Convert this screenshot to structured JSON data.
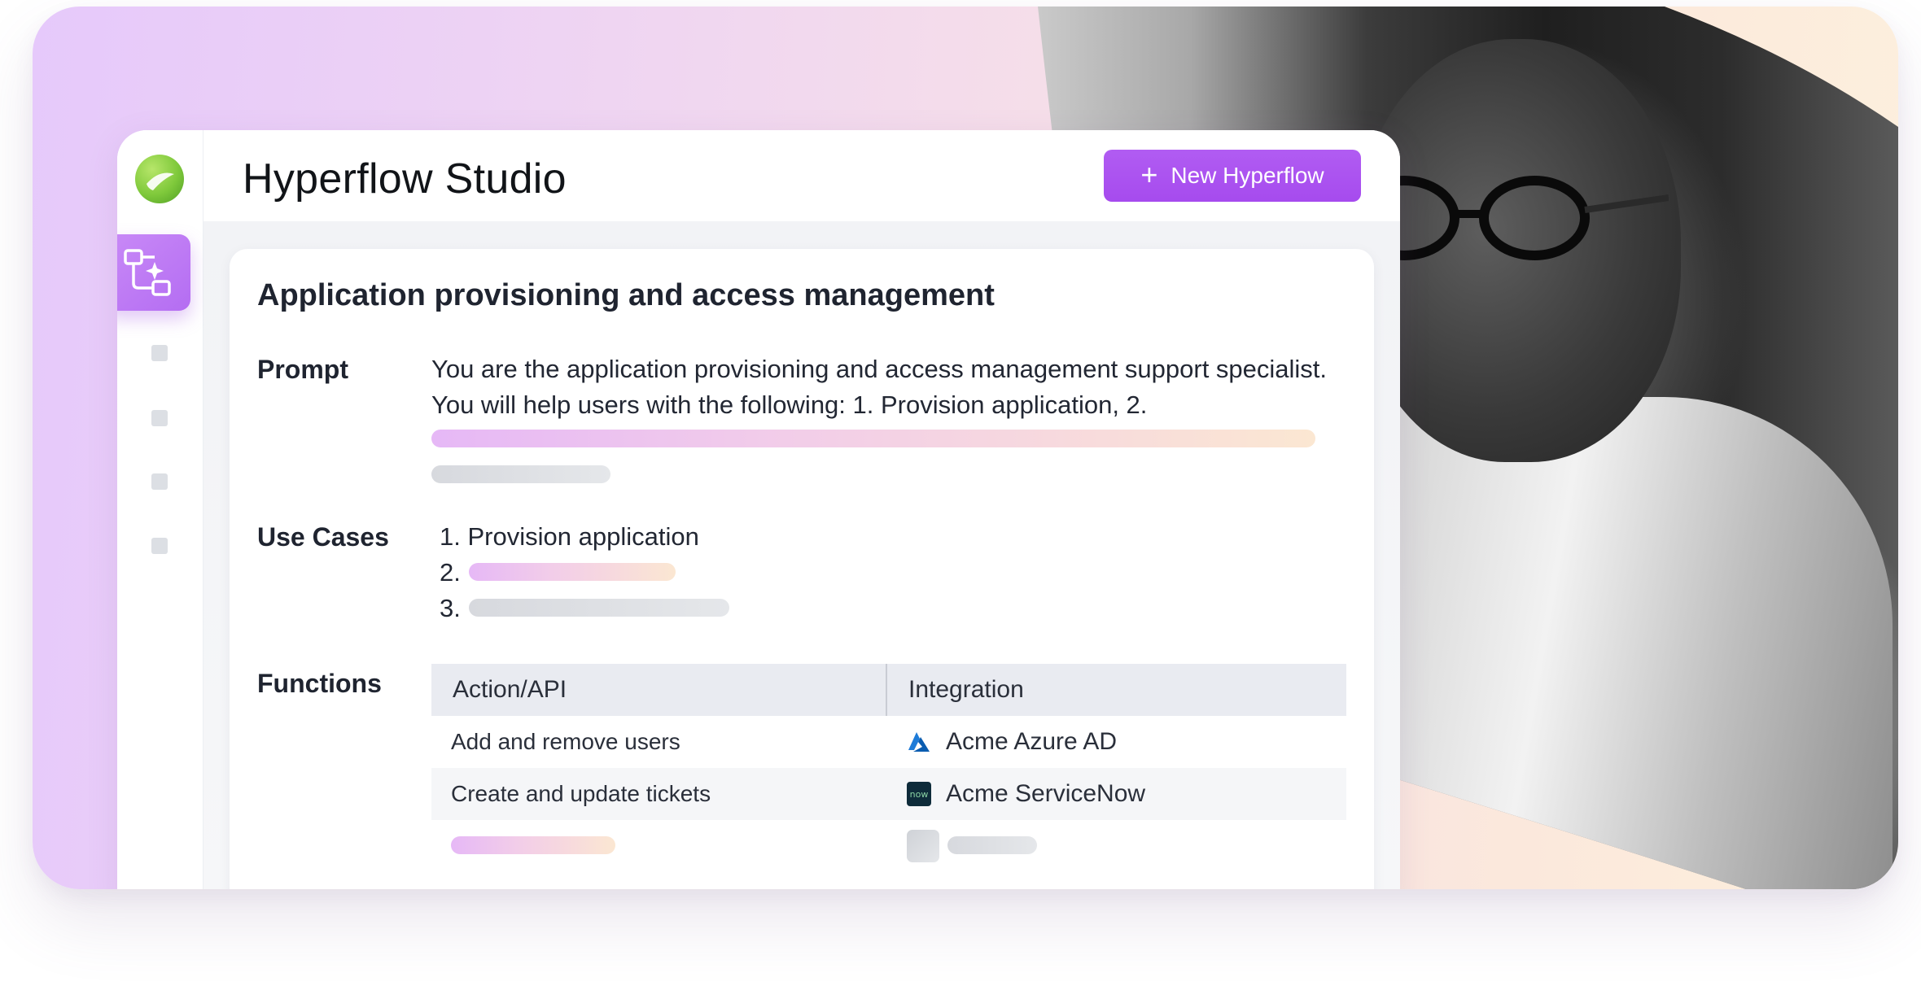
{
  "app": {
    "title": "Hyperflow  Studio",
    "new_button_label": "New Hyperflow"
  },
  "sidebar": {
    "items": [
      {
        "icon": "logo-icon"
      },
      {
        "icon": "workflow-sparkle-icon",
        "active": true
      },
      {
        "icon": "nav-placeholder-icon"
      },
      {
        "icon": "nav-placeholder-icon"
      },
      {
        "icon": "nav-placeholder-icon"
      },
      {
        "icon": "nav-placeholder-icon"
      }
    ]
  },
  "panel": {
    "title": "Application provisioning and access management",
    "prompt": {
      "label": "Prompt",
      "text": "You are the application provisioning and access management support specialist. You will help users with the following: 1. Provision application, 2."
    },
    "use_cases": {
      "label": "Use Cases",
      "items": [
        {
          "number": "1.",
          "text": "Provision application"
        },
        {
          "number": "2.",
          "text": ""
        },
        {
          "number": "3.",
          "text": ""
        }
      ]
    },
    "functions": {
      "label": "Functions",
      "columns": [
        "Action/API",
        "Integration"
      ],
      "rows": [
        {
          "action": "Add and remove users",
          "integration": "Acme Azure AD",
          "icon": "azure-ad-icon"
        },
        {
          "action": "Create and update tickets",
          "integration": "Acme ServiceNow",
          "icon": "servicenow-icon"
        }
      ],
      "servicenow_icon_text": "now"
    }
  },
  "colors": {
    "accent": "#a64bee",
    "active_nav": "#b46df2",
    "brand_green": "#7fc93b"
  }
}
